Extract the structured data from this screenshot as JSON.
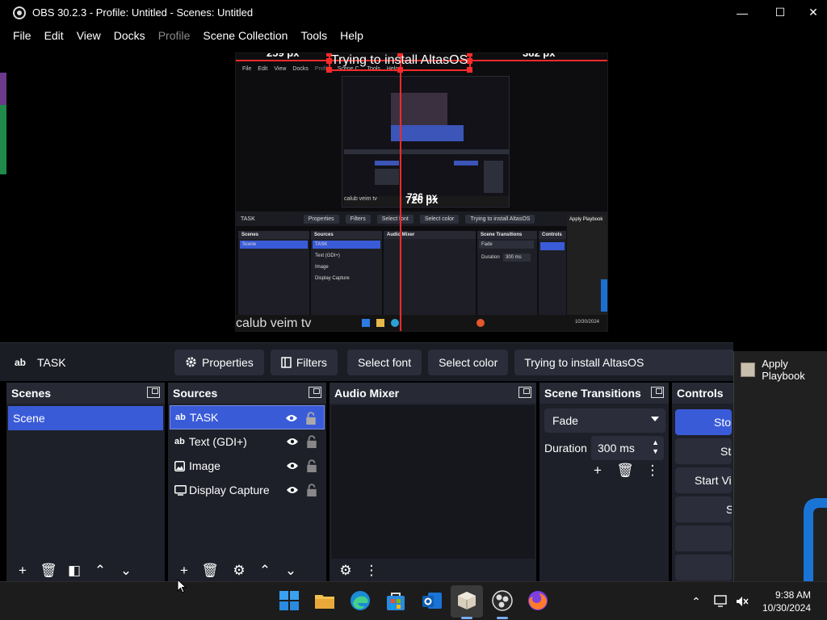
{
  "window": {
    "title": "OBS 30.2.3 - Profile: Untitled - Scenes: Untitled",
    "minimize": "—",
    "maximize": "☐",
    "close": "✕"
  },
  "menu": [
    "File",
    "Edit",
    "View",
    "Docks",
    "Profile",
    "Scene Collection",
    "Tools",
    "Help"
  ],
  "preview": {
    "measure_left": "259 px",
    "measure_right": "382 px",
    "measure_bottom": "726 px",
    "headline": "Trying to install AltasOS",
    "caption": "calub veim tv",
    "nested_caption": "calub veim tv",
    "nested_measure_bottom": "726 px",
    "mini_source": "TASK",
    "mini_menu": [
      "File",
      "Edit",
      "View",
      "Docks",
      "Profile",
      "Scene C.",
      "Tools",
      "Help"
    ],
    "mini_toolbar": [
      "Properties",
      "Filters",
      "Select font",
      "Select color",
      "Trying to install AltasOS"
    ],
    "mini_scenes_title": "Scenes",
    "mini_scene": "Scene",
    "mini_sources_title": "Sources",
    "mini_sources": [
      "TASK",
      "Text (GDI+)",
      "Image",
      "Display Capture"
    ],
    "mini_audio_title": "Audio Mixer",
    "mini_trans_title": "Scene Transitions",
    "mini_trans_value": "Fade",
    "mini_duration": "Duration",
    "mini_duration_value": "300 ms",
    "mini_controls_title": "Controls",
    "mini_popup": "Apply Playbook",
    "mini_clock": "10/30/2024"
  },
  "toolbar": {
    "source_badge": "ab",
    "source_name": "TASK",
    "properties": "Properties",
    "filters": "Filters",
    "select_font": "Select font",
    "select_color": "Select color",
    "text_value": "Trying to install AltasOS"
  },
  "docks": {
    "scenes": {
      "title": "Scenes",
      "items": [
        "Scene"
      ]
    },
    "sources": {
      "title": "Sources",
      "items": [
        {
          "badge": "ab",
          "name": "TASK"
        },
        {
          "badge": "ab",
          "name": "Text (GDI+)"
        },
        {
          "badge": "",
          "name": "Image"
        },
        {
          "badge": "",
          "name": "Display Capture"
        }
      ]
    },
    "audio": {
      "title": "Audio Mixer"
    },
    "transitions": {
      "title": "Scene Transitions",
      "selected": "Fade",
      "duration_label": "Duration",
      "duration_value": "300 ms"
    },
    "controls": {
      "title": "Controls",
      "buttons": [
        "Stop Streaming",
        "Start Recording",
        "Start Virtual Camera",
        "Studio Mode",
        "",
        ""
      ]
    }
  },
  "popup": {
    "title": "Apply Playbook"
  },
  "clock": {
    "time": "9:38 AM",
    "date": "10/30/2024"
  },
  "colors": {
    "accent": "#3a5bd8",
    "measure": "#ff2a2a",
    "panel": "#1e2029",
    "button": "#2b2e3a"
  }
}
